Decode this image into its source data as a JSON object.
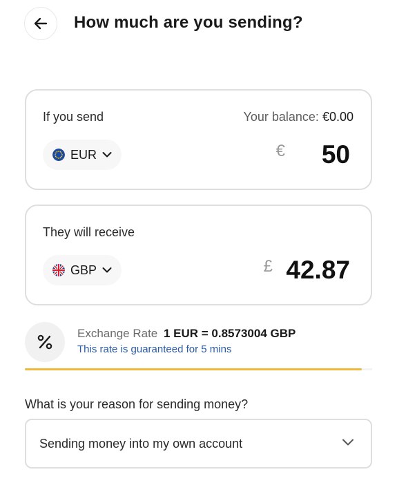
{
  "header": {
    "title": "How much are you sending?",
    "back_icon": "arrow-left-icon"
  },
  "send": {
    "label": "If you send",
    "balance_label": "Your balance:",
    "balance_value": "€0.00",
    "currency": "EUR",
    "currency_flag": "eu-flag-icon",
    "symbol": "€",
    "amount": "50"
  },
  "receive": {
    "label": "They will receive",
    "currency": "GBP",
    "currency_flag": "uk-flag-icon",
    "symbol": "£",
    "amount": "42.87"
  },
  "rate": {
    "icon": "percent-icon",
    "label": "Exchange Rate",
    "value": "1 EUR = 0.8573004 GBP",
    "note": "This rate is guaranteed for 5 mins",
    "progress_fraction": 0.97,
    "progress_color": "#f0b93e"
  },
  "reason": {
    "question": "What is your reason for sending money?",
    "selected": "Sending money into my own account"
  },
  "colors": {
    "accent_link": "#2a5aa6",
    "border": "#dedede"
  }
}
